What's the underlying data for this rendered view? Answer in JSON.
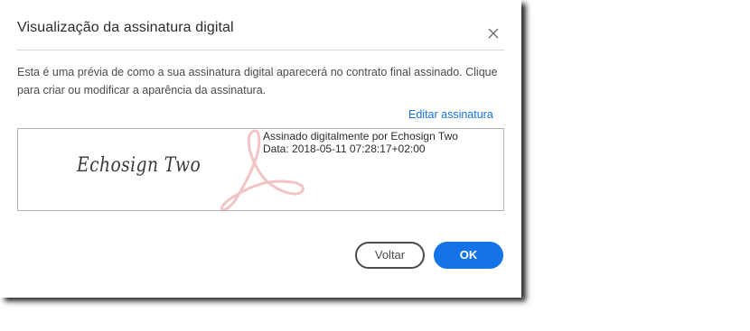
{
  "dialog": {
    "title": "Visualização da assinatura digital",
    "description": "Esta é uma prévia de como a sua assinatura digital aparecerá no contrato final assinado. Clique para criar ou modificar a aparência da assinatura.",
    "edit_link": "Editar assinatura",
    "close_icon": "close-icon"
  },
  "preview": {
    "signature_name": "Echosign Two",
    "signed_by": "Assinado digitalmente por Echosign Two",
    "date": "Data: 2018-05-11 07:28:17+02:00",
    "watermark_icon": "adobe-acrobat-logo"
  },
  "buttons": {
    "back_label": "Voltar",
    "ok_label": "OK"
  },
  "colors": {
    "accent": "#1473e6",
    "watermark": "#f2c4c4"
  }
}
